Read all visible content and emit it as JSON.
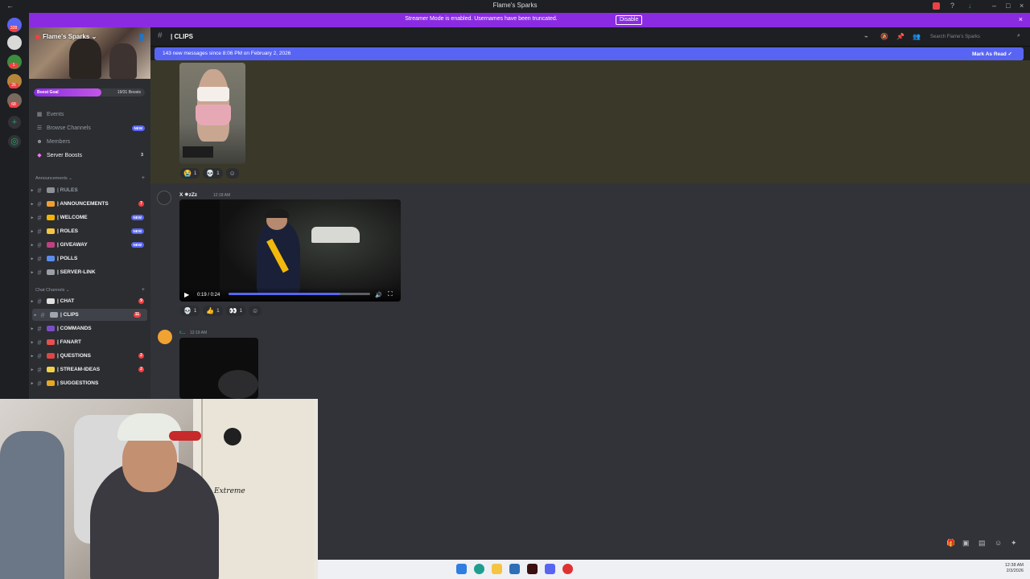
{
  "window": {
    "title": "Flame's Sparks"
  },
  "banner": {
    "message": "Streamer Mode is enabled. Usernames have been truncated.",
    "disable_label": "Disable",
    "close_icon": "×"
  },
  "rail": {
    "badges": [
      "328",
      "1",
      "26",
      "68"
    ]
  },
  "server": {
    "name": "Flame's Sparks",
    "boost_goal_label": "Boost Goal",
    "boost_count": "19/31 Boosts",
    "boost_progress": 0.61,
    "nav": [
      {
        "icon": "calendar-icon",
        "label": "Events",
        "badge": ""
      },
      {
        "icon": "browse-icon",
        "label": "Browse Channels",
        "badge": "NEW"
      },
      {
        "icon": "members-icon",
        "label": "Members",
        "badge": ""
      },
      {
        "icon": "boost-icon",
        "label": "Server Boosts",
        "badge": "3"
      }
    ],
    "categories": {
      "announcements": "Announcements",
      "chat": "Chat Channels"
    },
    "channels": [
      {
        "label": "| RULES",
        "badge": "",
        "color": "#8e9297"
      },
      {
        "label": "| ANNOUNCEMENTS",
        "badge": "7",
        "color": "#f0a030"
      },
      {
        "label": "| WELCOME",
        "badge": "NEW",
        "color": "#f2b400"
      },
      {
        "label": "| ROLES",
        "badge": "NEW",
        "color": "#f5c542"
      },
      {
        "label": "| GIVEAWAY",
        "badge": "NEW",
        "color": "#c04080"
      },
      {
        "label": "| POLLS",
        "badge": "",
        "color": "#5b8def"
      },
      {
        "label": "| SERVER-LINK",
        "badge": "",
        "color": "#9aa0a6"
      },
      {
        "label": "| CHAT",
        "badge": "9",
        "color": "#e0e0e0"
      },
      {
        "label": "| CLIPS",
        "badge": "11",
        "color": "#a0a6b0"
      },
      {
        "label": "| COMMANDS",
        "badge": "",
        "color": "#7b4ec8"
      },
      {
        "label": "| FANART",
        "badge": "",
        "color": "#e65050"
      },
      {
        "label": "| QUESTIONS",
        "badge": "2",
        "color": "#e04545"
      },
      {
        "label": "| STREAM-IDEAS",
        "badge": "2",
        "color": "#f2d14a"
      },
      {
        "label": "| SUGGESTIONS",
        "badge": "",
        "color": "#e8a820"
      }
    ]
  },
  "channel": {
    "name": "| CLIPS",
    "search_placeholder": "Search Flame's Sparks"
  },
  "new_messages": {
    "text": "143 new messages since 8:06 PM on February 2, 2026",
    "mark_label": "Mark As Read"
  },
  "messages": [
    {
      "reactions": [
        {
          "emoji": "😭",
          "count": "1"
        },
        {
          "emoji": "💀",
          "count": "1"
        }
      ]
    },
    {
      "author": "X ✷zZz",
      "time": "12:18 AM",
      "video_time": "0:19 / 0:24",
      "video_progress": 0.79,
      "reactions": [
        {
          "emoji": "💀",
          "count": "1"
        },
        {
          "emoji": "👍",
          "count": "1"
        },
        {
          "emoji": "👀",
          "count": "1"
        }
      ]
    },
    {
      "author": "r...",
      "time": "12:19 AM"
    }
  ],
  "taskbar": {
    "time": "12:38 AM",
    "date": "2/3/2026"
  },
  "colors": {
    "accent": "#5865f2",
    "streamer_banner": "#8a2be2",
    "badge_red": "#f23f43"
  }
}
